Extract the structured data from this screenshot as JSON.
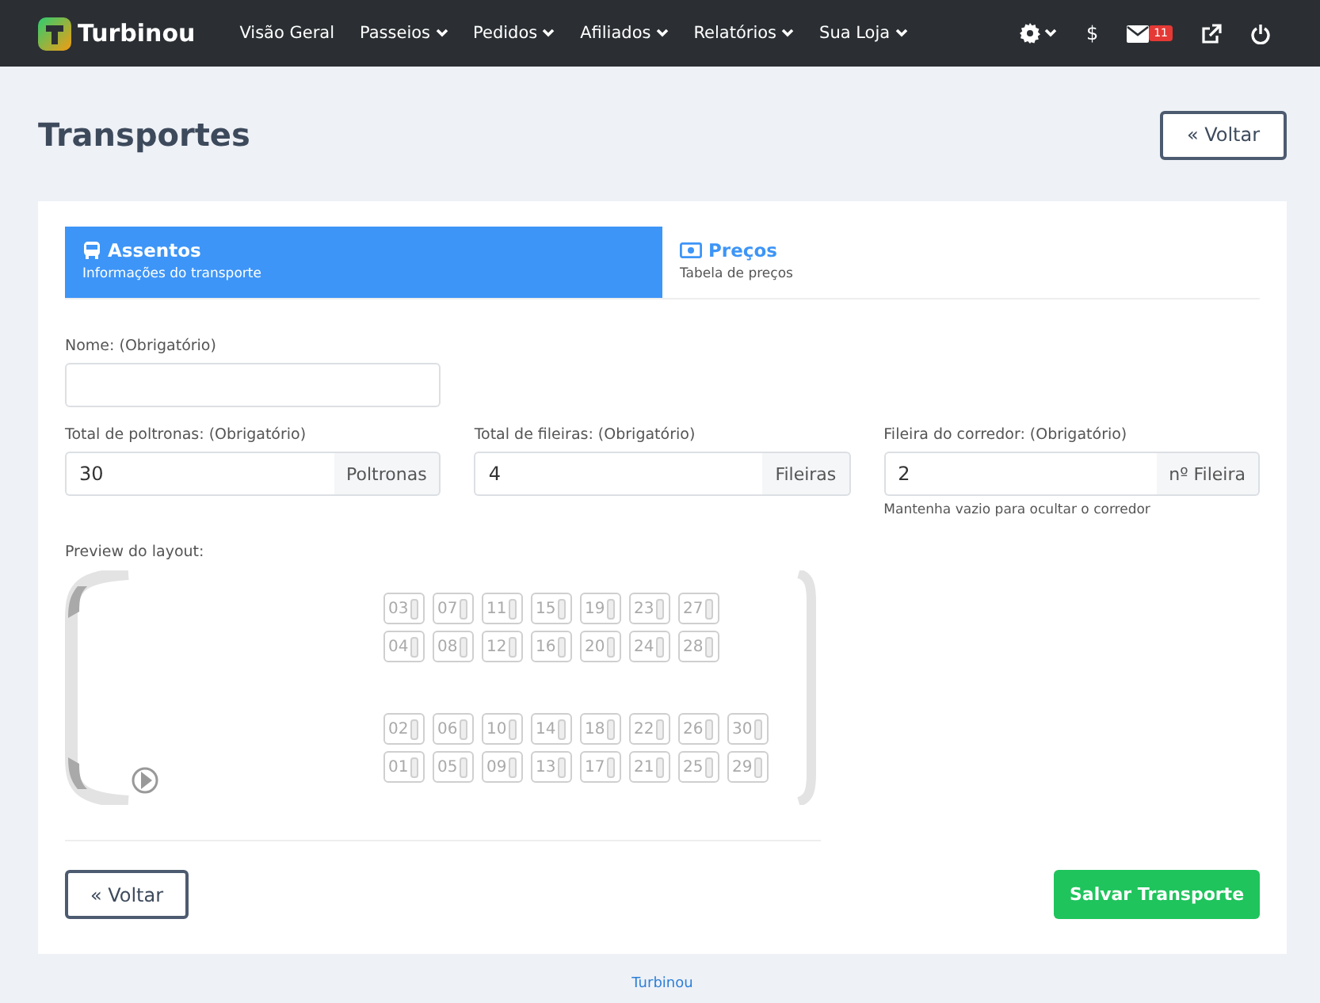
{
  "navbar": {
    "brand": "Turbinou",
    "menu": [
      {
        "label": "Visão Geral",
        "dropdown": false
      },
      {
        "label": "Passeios",
        "dropdown": true
      },
      {
        "label": "Pedidos",
        "dropdown": true
      },
      {
        "label": "Afiliados",
        "dropdown": true
      },
      {
        "label": "Relatórios",
        "dropdown": true
      },
      {
        "label": "Sua Loja",
        "dropdown": true
      }
    ],
    "tools": [
      {
        "kind": "settings",
        "dropdown": true
      },
      {
        "kind": "text",
        "label": "$"
      },
      {
        "kind": "mail",
        "badge": "11"
      },
      {
        "kind": "external"
      },
      {
        "kind": "power"
      }
    ]
  },
  "page": {
    "title": "Transportes",
    "back_button": "« Voltar"
  },
  "tabs": [
    {
      "kind": "bus",
      "label": "Assentos",
      "subtitle": "Informações do transporte",
      "selected": true
    },
    {
      "kind": "money",
      "label": "Preços",
      "subtitle": "Tabela de preços",
      "selected": false
    }
  ],
  "form": {
    "name": {
      "label": "Nome: (Obrigatório)"
    },
    "fields": [
      {
        "label": "Total de poltronas: (Obrigatório)",
        "value": "30",
        "addon": "Poltronas"
      },
      {
        "label": "Total de fileiras: (Obrigatório)",
        "value": "4",
        "addon": "Fileiras"
      },
      {
        "label": "Fileira do corredor: (Obrigatório)",
        "value": "2",
        "addon": "nº Fileira",
        "help": "Mantenha vazio para ocultar o corredor"
      }
    ]
  },
  "preview": {
    "label": "Preview do layout:",
    "rows": [
      {
        "kind": "seats",
        "seats": [
          "03",
          "07",
          "11",
          "15",
          "19",
          "23",
          "27"
        ]
      },
      {
        "kind": "seats",
        "seats": [
          "04",
          "08",
          "12",
          "16",
          "20",
          "24",
          "28"
        ]
      },
      {
        "kind": "aisle"
      },
      {
        "kind": "seats",
        "seats": [
          "02",
          "06",
          "10",
          "14",
          "18",
          "22",
          "26",
          "30"
        ]
      },
      {
        "kind": "seats",
        "seats": [
          "01",
          "05",
          "09",
          "13",
          "17",
          "21",
          "25",
          "29"
        ]
      }
    ]
  },
  "footer_buttons": {
    "back": "« Voltar",
    "save": "Salvar Transporte"
  },
  "footer": {
    "brand": "Turbinou"
  }
}
